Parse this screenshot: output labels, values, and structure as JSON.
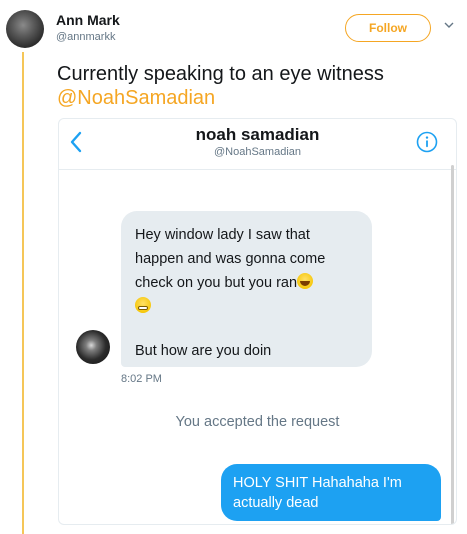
{
  "tweet": {
    "author_name": "Ann Mark",
    "author_handle": "@annmarkk",
    "follow_label": "Follow",
    "text": "Currently speaking to an eye witness",
    "mention": "@NoahSamadian"
  },
  "dm": {
    "contact_name": "noah samadian",
    "contact_handle": "@NoahSamadian",
    "incoming": {
      "line1": "Hey window lady I saw that",
      "line2": "happen and was gonna come",
      "line3": "check on you but you ran",
      "line4": "But how are you doin"
    },
    "timestamp": "8:02 PM",
    "system_message": "You accepted the request",
    "outgoing": {
      "line1": "HOLY SHIT Hahahaha I'm",
      "line2": "actually dead"
    }
  },
  "icons": {
    "back": "chevron-left-icon",
    "info": "info-icon",
    "menu": "chevron-down-icon"
  },
  "colors": {
    "accent": "#f5a623",
    "dm_blue": "#1da1f2",
    "incoming_bubble": "#e6ecf0",
    "thread_line": "#f5c658"
  }
}
